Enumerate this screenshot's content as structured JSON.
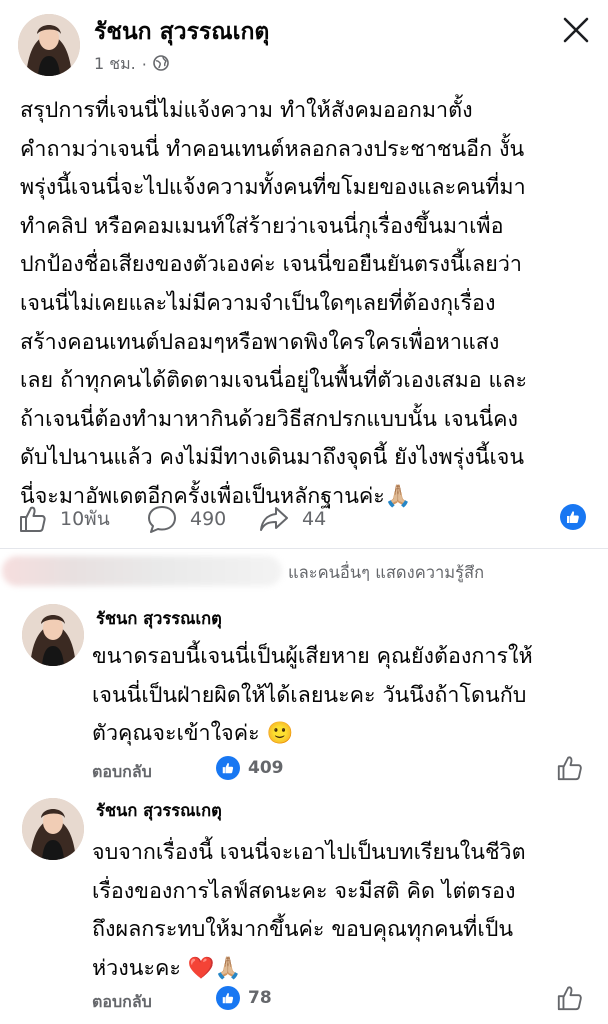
{
  "post": {
    "author": "รัชนก สุวรรณเกตุ",
    "time": "1 ชม.",
    "separator": "·",
    "body_lines": [
      "สรุปการที่เจนนี่ไม่แจ้งความ ทำให้สังคมออกมาตั้ง",
      "คำถามว่าเจนนี่ ทำคอนเทนต์หลอกลวงประชาชนอีก งั้น",
      "พรุ่งนี้เจนนี่จะไปแจ้งความทั้งคนที่ขโมยของและคนที่มา",
      "ทำคลิป หรือคอมเมนท์ใส่ร้ายว่าเจนนี่กุเรื่องขึ้นมาเพื่อ",
      "ปกป้องชื่อเสียงของตัวเองค่ะ เจนนี่ขอยืนยันตรงนี้เลยว่า",
      "เจนนี่ไม่เคยและไม่มีความจำเป็นใดๆเลยที่ต้องกุเรื่อง",
      "สร้างคอนเทนต์ปลอมๆหรือพาดพิงใครใครเพื่อหาแสง",
      "เลย ถ้าทุกคนได้ติดตามเจนนี่อยู่ในพื้นที่ตัวเองเสมอ และ",
      "ถ้าเจนนี่ต้องทำมาหากินด้วยวิธีสกปรกแบบนั้น เจนนี่คง",
      "ดับไปนานแล้ว คงไม่มีทางเดินมาถึงจุดนี้ ยังไงพรุ่งนี้เจน",
      "นี่จะมาอัพเดตอีกครั้งเพื่อเป็นหลักฐานค่ะ🙏🏼"
    ],
    "likes": "10พัน",
    "comments": "490",
    "shares": "44"
  },
  "reactors_text": "และคนอื่นๆ แสดงความรู้สึก",
  "comments": [
    {
      "author": "รัชนก สุวรรณเกตุ",
      "lines": [
        "ขนาดรอบนี้เจนนี่เป็นผู้เสียหาย คุณยังต้องการให้",
        "เจนนี่เป็นฝ่ายผิดให้ได้เลยนะคะ วันนึงถ้าโดนกับ",
        "ตัวคุณจะเข้าใจค่ะ 🙂"
      ],
      "reply": "ตอบกลับ",
      "reactions": "409"
    },
    {
      "author": "รัชนก สุวรรณเกตุ",
      "lines": [
        "จบจากเรื่องนี้ เจนนี่จะเอาไปเป็นบทเรียนในชีวิต",
        "เรื่องของการไลฟ์สดนะคะ จะมีสติ คิด ไต่ตรอง",
        "ถึงผลกระทบให้มากขึ้นค่ะ ขอบคุณทุกคนที่เป็น",
        "ห่วงนะคะ ❤️🙏🏼"
      ],
      "reply": "ตอบกลับ",
      "reactions": "78"
    }
  ],
  "icons": {
    "close": "close-icon",
    "globe": "globe-icon",
    "like": "thumbs-up-icon",
    "comment": "comment-bubble-icon",
    "share": "share-arrow-icon"
  },
  "colors": {
    "brand_blue": "#1877f2",
    "secondary_text": "#65676b"
  }
}
